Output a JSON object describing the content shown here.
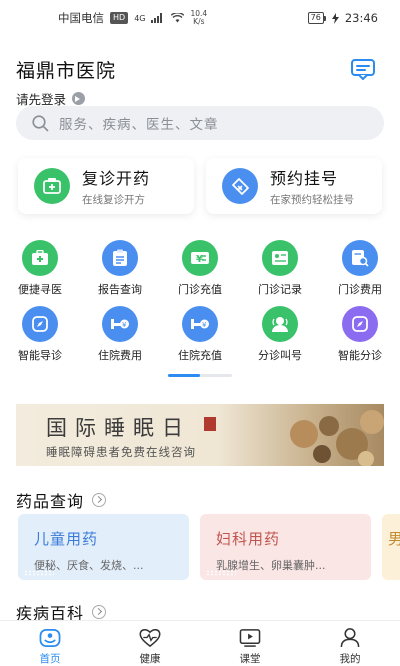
{
  "status_bar": {
    "carrier": "中国电信",
    "hd": "HD",
    "signal": "4G",
    "net_speed_value": "10.4",
    "net_speed_unit": "K/s",
    "battery": "76",
    "time": "23:46"
  },
  "header": {
    "title": "福鼎市医院",
    "login_prompt": "请先登录"
  },
  "search": {
    "placeholder": "服务、疾病、医生、文章"
  },
  "quick_cards": [
    {
      "title": "复诊开药",
      "subtitle": "在线复诊开方",
      "icon": "prescription-icon",
      "color": "#3ac26a"
    },
    {
      "title": "预约挂号",
      "subtitle": "在家预约轻松挂号",
      "icon": "ticket-icon",
      "color": "#4a8ff0"
    }
  ],
  "services": [
    {
      "label": "便捷寻医",
      "icon": "medical-kit-icon",
      "color": "#3ac26a"
    },
    {
      "label": "报告查询",
      "icon": "report-icon",
      "color": "#4a8ff0"
    },
    {
      "label": "门诊充值",
      "icon": "yuan-card-icon",
      "color": "#3ac26a"
    },
    {
      "label": "门诊记录",
      "icon": "record-icon",
      "color": "#3ac26a"
    },
    {
      "label": "门诊费用",
      "icon": "fee-search-icon",
      "color": "#4a8ff0"
    },
    {
      "label": "智能导诊",
      "icon": "compass-icon",
      "color": "#4a8ff0"
    },
    {
      "label": "住院费用",
      "icon": "bed-fee-icon",
      "color": "#4a8ff0"
    },
    {
      "label": "住院充值",
      "icon": "bed-topup-icon",
      "color": "#4a8ff0"
    },
    {
      "label": "分诊叫号",
      "icon": "queue-call-icon",
      "color": "#3ac26a"
    },
    {
      "label": "智能分诊",
      "icon": "smart-triage-icon",
      "color": "#8b6cf0"
    }
  ],
  "banner": {
    "title": "国际睡眠日",
    "subtitle": "睡眠障碍患者免费在线咨询"
  },
  "drug_section": {
    "title": "药品查询",
    "cards": [
      {
        "title": "儿童用药",
        "subtitle": "便秘、厌食、发烧、...",
        "bg": "#e3eefb",
        "color": "#3b7bd8"
      },
      {
        "title": "妇科用药",
        "subtitle": "乳腺增生、卵巢囊肿...",
        "bg": "#fbe6e6",
        "color": "#c0554f"
      },
      {
        "title": "男",
        "subtitle": "",
        "bg": "#fdf0d8",
        "color": "#c08a2e"
      }
    ]
  },
  "disease_section": {
    "title": "疾病百科"
  },
  "tab_bar": [
    {
      "label": "首页",
      "icon": "home-icon",
      "active": true
    },
    {
      "label": "健康",
      "icon": "heart-pulse-icon",
      "active": false
    },
    {
      "label": "课堂",
      "icon": "video-class-icon",
      "active": false
    },
    {
      "label": "我的",
      "icon": "user-icon",
      "active": false
    }
  ],
  "colors": {
    "accent": "#2a8cf0",
    "green": "#3ac26a",
    "blue": "#4a8ff0",
    "purple": "#8b6cf0"
  }
}
